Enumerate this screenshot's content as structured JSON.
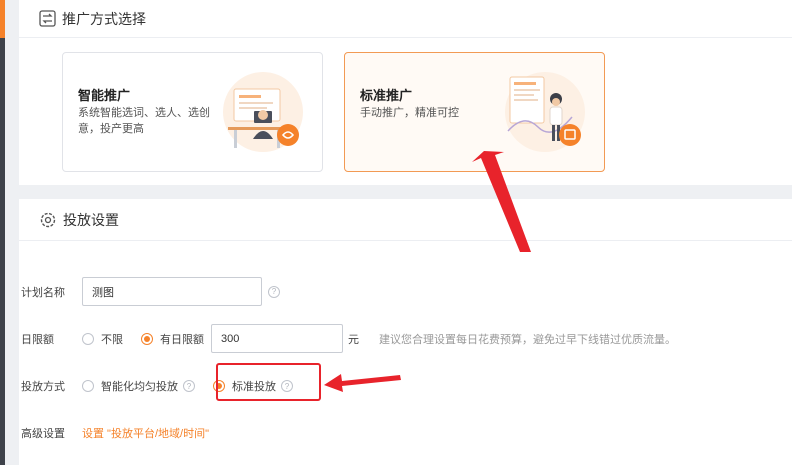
{
  "promotion": {
    "section_title": "推广方式选择",
    "options": [
      {
        "title": "智能推广",
        "desc": "系统智能选词、选人、选创意，投产更高",
        "selected": false
      },
      {
        "title": "标准推广",
        "desc": "手动推广，精准可控",
        "selected": true
      }
    ]
  },
  "settings": {
    "section_title": "投放设置",
    "plan_name": {
      "label": "计划名称",
      "value": "测图"
    },
    "daily_limit": {
      "label": "日限额",
      "options": [
        {
          "label": "不限",
          "selected": false
        },
        {
          "label": "有日限额",
          "selected": true
        }
      ],
      "value": "300",
      "unit": "元",
      "hint": "建议您合理设置每日花费预算，避免过早下线错过优质流量。"
    },
    "delivery_method": {
      "label": "投放方式",
      "options": [
        {
          "label": "智能化均匀投放",
          "selected": false
        },
        {
          "label": "标准投放",
          "selected": true
        }
      ]
    },
    "advanced": {
      "label": "高级设置",
      "link": "设置 \"投放平台/地域/时间\""
    }
  },
  "colors": {
    "accent": "#f5822a",
    "annotation": "#e8232b"
  }
}
